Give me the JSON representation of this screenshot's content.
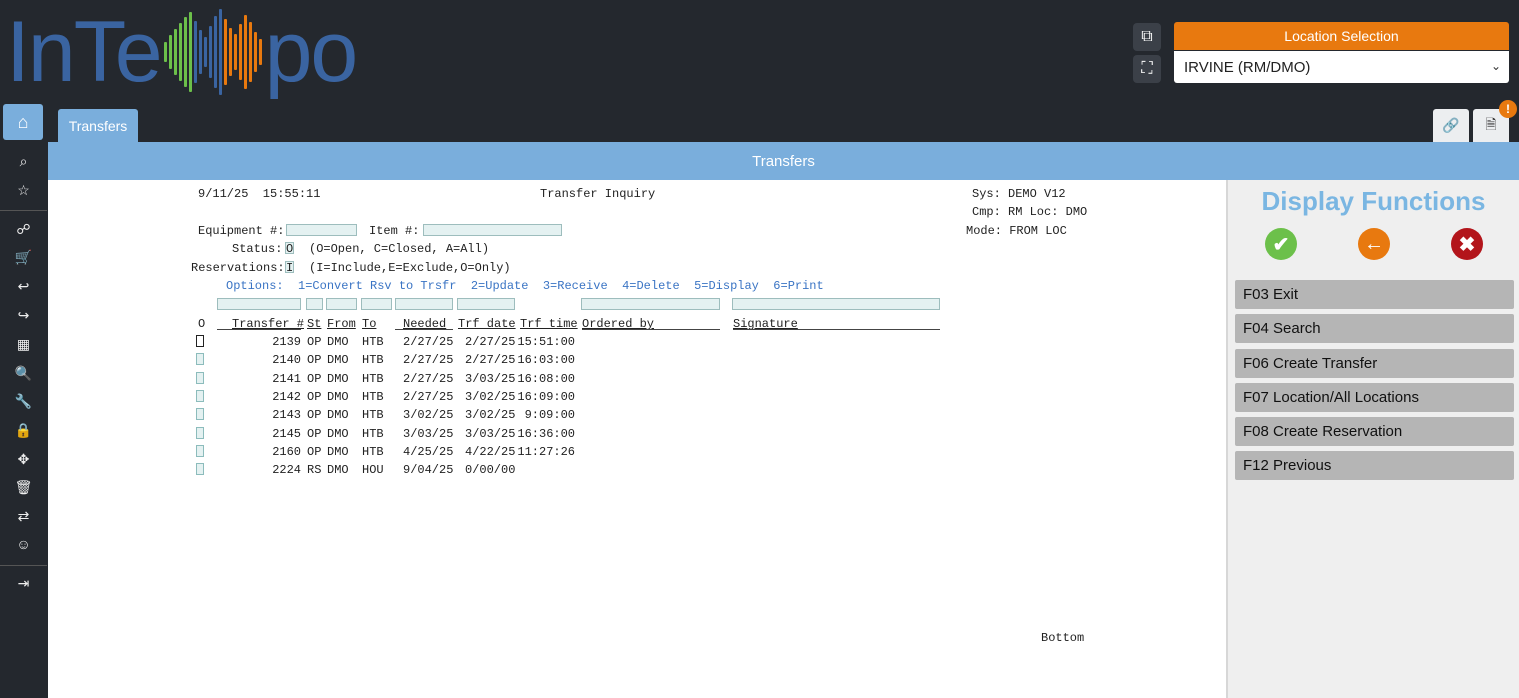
{
  "header": {
    "logo_text_left": "InTe",
    "logo_text_right": "po",
    "location_label": "Location Selection",
    "location_value": "IRVINE (RM/DMO)"
  },
  "tabs": [
    {
      "label": "Transfers"
    }
  ],
  "badge": "!",
  "page_title": "Transfers",
  "screen": {
    "datetime": "9/11/25  15:55:11",
    "title": "Transfer Inquiry",
    "sys": "Sys: DEMO V12",
    "cmp": "Cmp: RM Loc: DMO",
    "mode": "Mode: FROM LOC",
    "equip_label": "Equipment #:",
    "item_label": "Item #:",
    "status_label": "Status:",
    "status_value": "O",
    "status_help": "(O=Open, C=Closed, A=All)",
    "resv_label": "Reservations:",
    "resv_value": "I",
    "resv_help": "(I=Include,E=Exclude,O=Only)",
    "options": "Options:  1=Convert Rsv to Trsfr  2=Update  3=Receive  4=Delete  5=Display  6=Print",
    "columns": {
      "o": "O",
      "transfer": "Transfer #",
      "st": "St",
      "from": "From",
      "to": "To",
      "needed": "Needed",
      "trf_date": "Trf date",
      "trf_time": "Trf time",
      "ordered_by": "Ordered by",
      "signature": "Signature"
    },
    "rows": [
      {
        "transfer": "2139",
        "st": "OP",
        "from": "DMO",
        "to": "HTB",
        "needed": "2/27/25",
        "trf_date": "2/27/25",
        "trf_time": "15:51:00"
      },
      {
        "transfer": "2140",
        "st": "OP",
        "from": "DMO",
        "to": "HTB",
        "needed": "2/27/25",
        "trf_date": "2/27/25",
        "trf_time": "16:03:00"
      },
      {
        "transfer": "2141",
        "st": "OP",
        "from": "DMO",
        "to": "HTB",
        "needed": "2/27/25",
        "trf_date": "3/03/25",
        "trf_time": "16:08:00"
      },
      {
        "transfer": "2142",
        "st": "OP",
        "from": "DMO",
        "to": "HTB",
        "needed": "2/27/25",
        "trf_date": "3/02/25",
        "trf_time": "16:09:00"
      },
      {
        "transfer": "2143",
        "st": "OP",
        "from": "DMO",
        "to": "HTB",
        "needed": "3/02/25",
        "trf_date": "3/02/25",
        "trf_time": "9:09:00"
      },
      {
        "transfer": "2145",
        "st": "OP",
        "from": "DMO",
        "to": "HTB",
        "needed": "3/03/25",
        "trf_date": "3/03/25",
        "trf_time": "16:36:00"
      },
      {
        "transfer": "2160",
        "st": "OP",
        "from": "DMO",
        "to": "HTB",
        "needed": "4/25/25",
        "trf_date": "4/22/25",
        "trf_time": "11:27:26"
      },
      {
        "transfer": "2224",
        "st": "RS",
        "from": "DMO",
        "to": "HOU",
        "needed": "9/04/25",
        "trf_date": "0/00/00",
        "trf_time": ""
      }
    ],
    "bottom": "Bottom"
  },
  "panel": {
    "title": "Display Functions",
    "keys": [
      {
        "label": "F03  Exit"
      },
      {
        "label": "F04  Search"
      },
      {
        "label": "F06  Create Transfer"
      },
      {
        "label": "F07  Location/All Locations"
      },
      {
        "label": "F08  Create Reservation"
      },
      {
        "label": "F12  Previous"
      }
    ]
  },
  "colors": {
    "accent": "#7aaedc",
    "orange": "#e8790f",
    "logo_blue": "#3a64a1",
    "ok_green": "#6cc04a",
    "cancel_red": "#b3151b"
  }
}
